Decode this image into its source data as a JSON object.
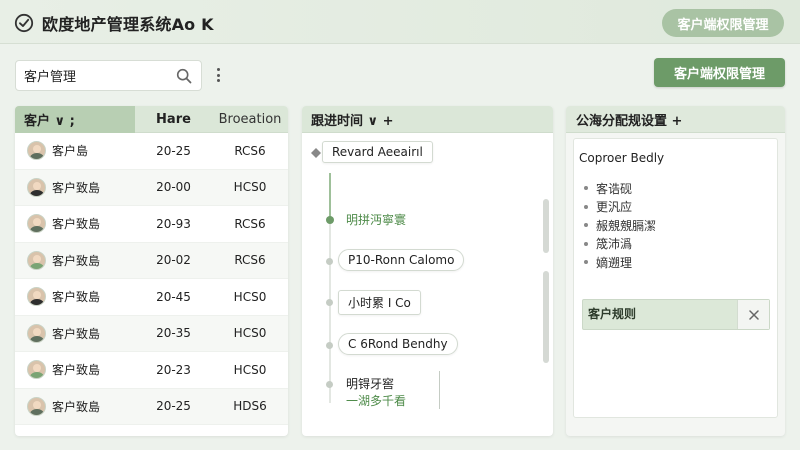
{
  "header": {
    "title": "欧度地产管理系统Ao K",
    "top_button_label": "客户端权限管理"
  },
  "toolbar": {
    "search_value": "客户管理",
    "search_placeholder": "客户管理",
    "main_button_label": "客户端权限管理"
  },
  "customers": {
    "headers": {
      "name": "客户 ∨ ;",
      "age": "Hare",
      "location": "Broeation"
    },
    "rows": [
      {
        "name": "客户島",
        "age": "20-25",
        "loc": "RCS6",
        "avatar": "male"
      },
      {
        "name": "客户致島",
        "age": "20-00",
        "loc": "HCS0",
        "avatar": "female"
      },
      {
        "name": "客户致島",
        "age": "20-93",
        "loc": "RCS6",
        "avatar": "male"
      },
      {
        "name": "客户致島",
        "age": "20-02",
        "loc": "RCS6",
        "avatar": "male-green"
      },
      {
        "name": "客户致島",
        "age": "20-45",
        "loc": "HCS0",
        "avatar": "female"
      },
      {
        "name": "客户致島",
        "age": "20-35",
        "loc": "HCS0",
        "avatar": "male"
      },
      {
        "name": "客户致島",
        "age": "20-23",
        "loc": "HCS0",
        "avatar": "male-green"
      },
      {
        "name": "客户致島",
        "age": "20-25",
        "loc": "HDS6",
        "avatar": "male"
      }
    ]
  },
  "timeline": {
    "header": "跟进时间 ∨ +",
    "items": [
      {
        "text": "Revard Aeeairıl"
      },
      {
        "text": "明拼沔寧寰"
      },
      {
        "text": "P10-Ronn Calomo"
      },
      {
        "text": "小时累 I Co"
      },
      {
        "text": "C 6Rond Bendhy"
      },
      {
        "text": "明锝牙窖"
      },
      {
        "text": "一湖多千看"
      }
    ]
  },
  "settings": {
    "header": "公海分配规设置 +",
    "card_title": "Coproer Bedly",
    "list": [
      "客诰砚",
      "更汎应",
      "赧覫覫膈潔",
      "筬沛潙",
      "嫡遡理"
    ],
    "selected_tag": "客户规则"
  },
  "colors": {
    "accent": "#6d9b68",
    "header_bg": "#dbe7d8",
    "soft_button": "#a9c3a4"
  }
}
